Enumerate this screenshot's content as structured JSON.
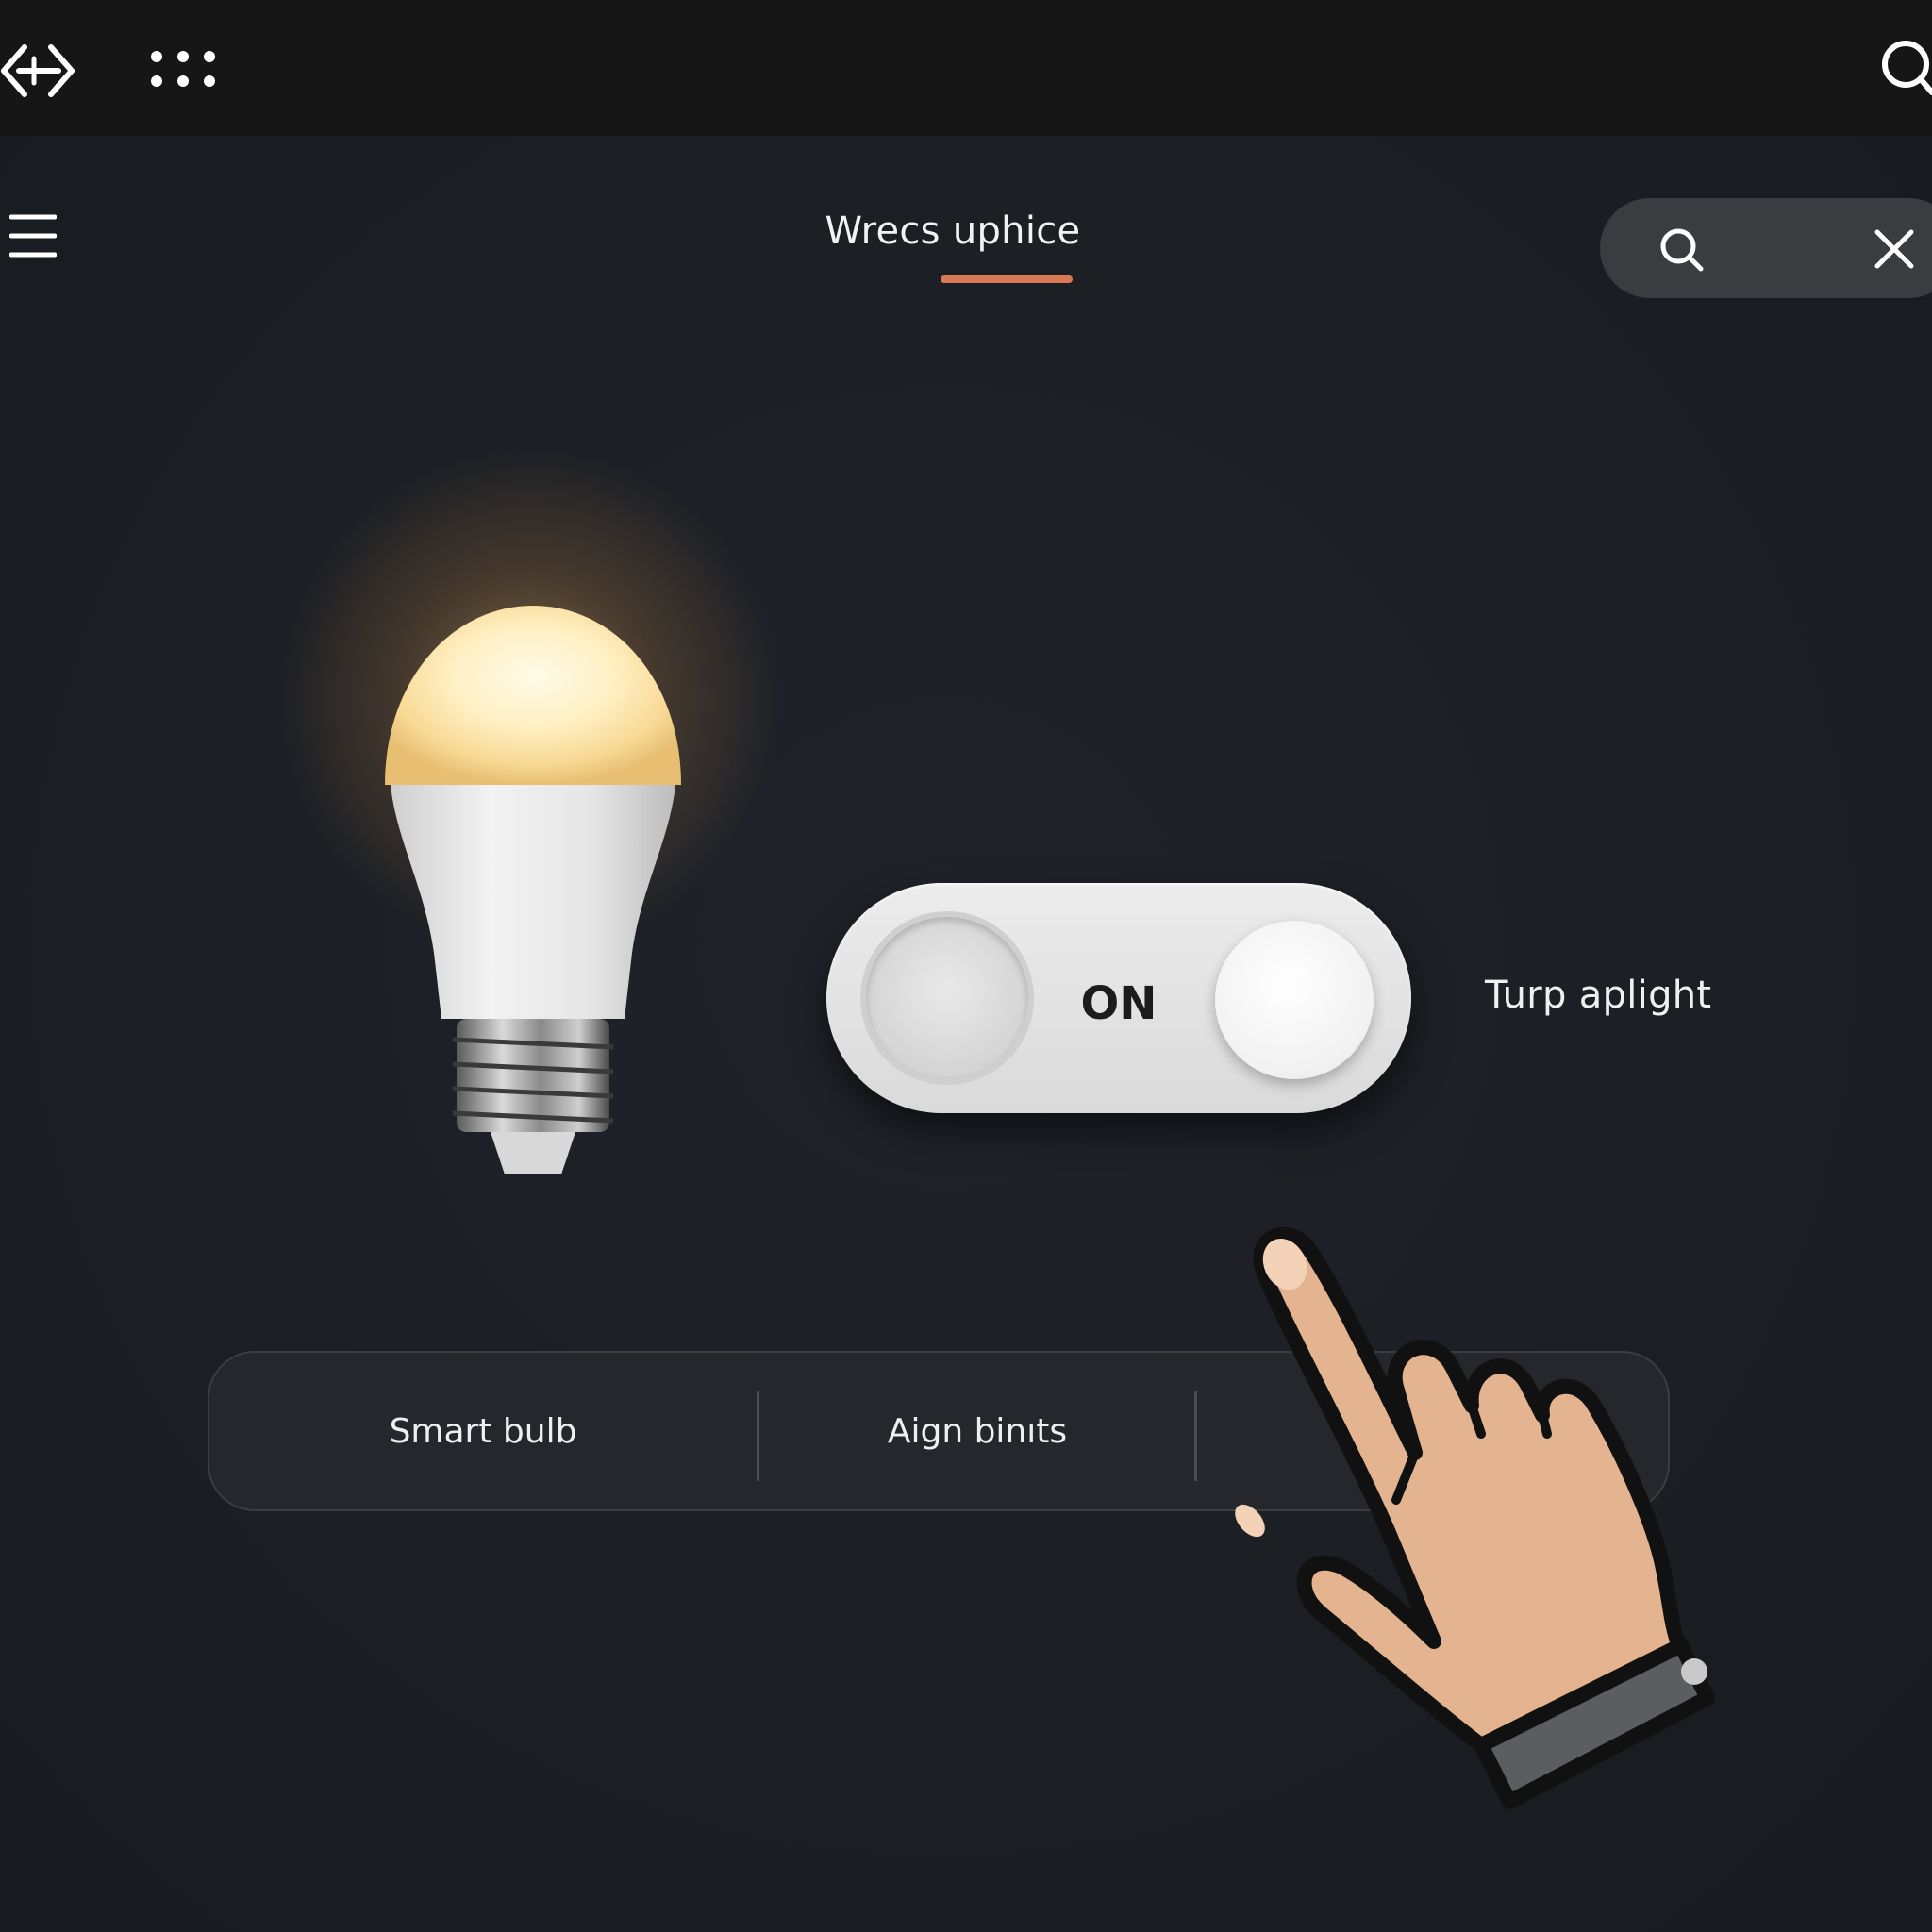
{
  "topbar": {
    "back_forward_icon": "back-forward-icon",
    "apps_icon": "apps-grid-icon",
    "search_icon": "search-icon"
  },
  "header": {
    "menu_icon": "hamburger-menu-icon",
    "title": "Wrecs uphice",
    "accent_color": "#d97a54",
    "search_pill": {
      "search_icon": "search-icon",
      "close_icon": "close-icon"
    }
  },
  "device": {
    "icon": "light-bulb-icon",
    "state_glow_color": "#ffd27a"
  },
  "toggle": {
    "label": "ON",
    "caption": "Turp aplight",
    "state": "on"
  },
  "segments": [
    {
      "label": "Smart bulb"
    },
    {
      "label": "Aign binıts"
    },
    {
      "label": ""
    }
  ],
  "cursor": {
    "icon": "pointing-hand-cursor-icon"
  }
}
